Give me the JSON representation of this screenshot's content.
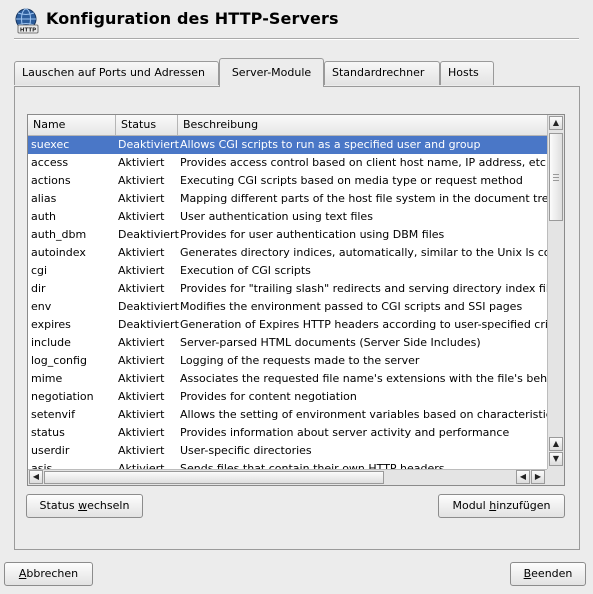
{
  "window": {
    "title": "Konfiguration des HTTP-Servers",
    "icon": "http-server-icon",
    "icon_text": "HTTP"
  },
  "tabs": [
    {
      "label": "Lauschen auf Ports und Adressen",
      "active": false
    },
    {
      "label": "Server-Module",
      "active": true
    },
    {
      "label": "Standardrechner",
      "active": false
    },
    {
      "label": "Hosts",
      "active": false
    }
  ],
  "table": {
    "columns": [
      "Name",
      "Status",
      "Beschreibung"
    ],
    "rows": [
      {
        "name": "suexec",
        "status": "Deaktiviert",
        "desc": "Allows CGI scripts to run as a specified user and group",
        "selected": true
      },
      {
        "name": "access",
        "status": "Aktiviert",
        "desc": "Provides access control based on client host name, IP address, etc.",
        "selected": false
      },
      {
        "name": "actions",
        "status": "Aktiviert",
        "desc": "Executing CGI scripts based on media type or request method",
        "selected": false
      },
      {
        "name": "alias",
        "status": "Aktiviert",
        "desc": "Mapping different parts of the host file system in the document tree a",
        "selected": false
      },
      {
        "name": "auth",
        "status": "Aktiviert",
        "desc": "User authentication using text files",
        "selected": false
      },
      {
        "name": "auth_dbm",
        "status": "Deaktiviert",
        "desc": "Provides for user authentication using DBM files",
        "selected": false
      },
      {
        "name": "autoindex",
        "status": "Aktiviert",
        "desc": "Generates directory indices, automatically, similar to the Unix ls com",
        "selected": false
      },
      {
        "name": "cgi",
        "status": "Aktiviert",
        "desc": "Execution of CGI scripts",
        "selected": false
      },
      {
        "name": "dir",
        "status": "Aktiviert",
        "desc": "Provides for \"trailing slash\" redirects and serving directory index files",
        "selected": false
      },
      {
        "name": "env",
        "status": "Deaktiviert",
        "desc": "Modifies the environment passed to CGI scripts and SSI pages",
        "selected": false
      },
      {
        "name": "expires",
        "status": "Deaktiviert",
        "desc": "Generation of Expires HTTP headers according to user-specified cri",
        "selected": false
      },
      {
        "name": "include",
        "status": "Aktiviert",
        "desc": "Server-parsed HTML documents (Server Side Includes)",
        "selected": false
      },
      {
        "name": "log_config",
        "status": "Aktiviert",
        "desc": "Logging of the requests made to the server",
        "selected": false
      },
      {
        "name": "mime",
        "status": "Aktiviert",
        "desc": "Associates the requested file name's extensions with the file's beha",
        "selected": false
      },
      {
        "name": "negotiation",
        "status": "Aktiviert",
        "desc": "Provides for content negotiation",
        "selected": false
      },
      {
        "name": "setenvif",
        "status": "Aktiviert",
        "desc": "Allows the setting of environment variables based on characteristics",
        "selected": false
      },
      {
        "name": "status",
        "status": "Aktiviert",
        "desc": "Provides information about server activity and performance",
        "selected": false
      },
      {
        "name": "userdir",
        "status": "Aktiviert",
        "desc": "User-specific directories",
        "selected": false
      },
      {
        "name": "asis",
        "status": "Aktiviert",
        "desc": "Sends files that contain their own HTTP headers",
        "selected": false
      }
    ]
  },
  "buttons": {
    "status_toggle": {
      "pre": "Status ",
      "mnemonic": "w",
      "post": "echseln"
    },
    "add_module": {
      "pre": "Modul ",
      "mnemonic": "h",
      "post": "inzufügen"
    },
    "cancel": {
      "pre": "",
      "mnemonic": "A",
      "post": "bbrechen"
    },
    "finish": {
      "pre": "",
      "mnemonic": "B",
      "post": "eenden"
    }
  },
  "colors": {
    "selection": "#4a77c7",
    "window_bg": "#ececec"
  }
}
